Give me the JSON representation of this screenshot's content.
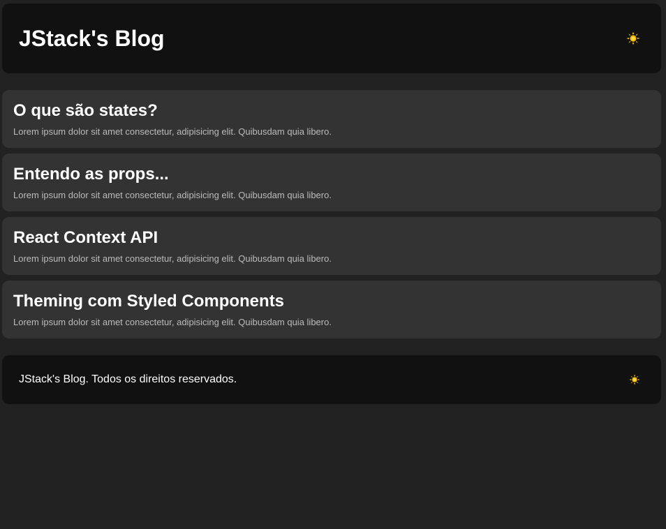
{
  "header": {
    "title": "JStack's Blog",
    "theme_toggle_icon": "sun-icon"
  },
  "posts": [
    {
      "title": "O que são states?",
      "description": "Lorem ipsum dolor sit amet consectetur, adipisicing elit. Quibusdam quia libero."
    },
    {
      "title": "Entendo as props...",
      "description": "Lorem ipsum dolor sit amet consectetur, adipisicing elit. Quibusdam quia libero."
    },
    {
      "title": "React Context API",
      "description": "Lorem ipsum dolor sit amet consectetur, adipisicing elit. Quibusdam quia libero."
    },
    {
      "title": "Theming com Styled Components",
      "description": "Lorem ipsum dolor sit amet consectetur, adipisicing elit. Quibusdam quia libero."
    }
  ],
  "footer": {
    "text": "JStack's Blog. Todos os direitos reservados.",
    "theme_toggle_icon": "sun-icon"
  },
  "colors": {
    "background": "#222222",
    "header_bg": "#111111",
    "card_bg": "#333333",
    "sun": "#F5B800"
  }
}
